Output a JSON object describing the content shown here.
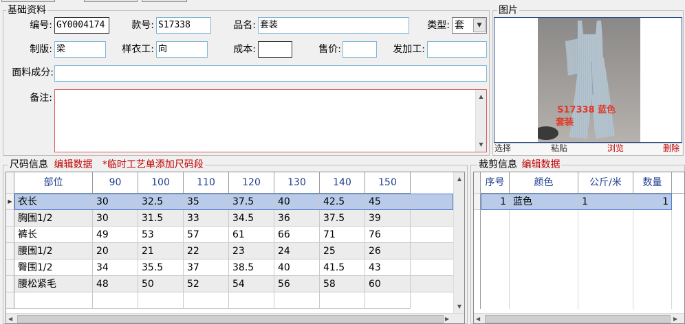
{
  "basic": {
    "title": "基础资料",
    "labels": {
      "code": "编号:",
      "style": "款号:",
      "name": "品名:",
      "type": "类型:",
      "maker": "制版:",
      "sample": "样衣工:",
      "cost": "成本:",
      "price": "售价:",
      "process": "发加工:",
      "fabric": "面料成分:",
      "remark": "备注:"
    },
    "values": {
      "code": "GY0004174",
      "style": "S17338",
      "name": "套装",
      "type": "套",
      "maker": "梁",
      "sample": "向",
      "cost": "",
      "price": "",
      "process": "",
      "fabric": "",
      "remark": ""
    }
  },
  "picture": {
    "title": "图片",
    "caption_line1": "S17338  蓝色",
    "caption_line2": "套装",
    "buttons": {
      "select": "选择",
      "paste": "粘贴",
      "browse": "浏览",
      "delete": "删除"
    }
  },
  "size_info": {
    "title": "尺码信息",
    "edit": "编辑数据",
    "note": "*临时工艺单添加尺码段",
    "headers": [
      "部位",
      "90",
      "100",
      "110",
      "120",
      "130",
      "140",
      "150"
    ],
    "rows": [
      [
        "衣长",
        "30",
        "32.5",
        "35",
        "37.5",
        "40",
        "42.5",
        "45"
      ],
      [
        "胸围1/2",
        "30",
        "31.5",
        "33",
        "34.5",
        "36",
        "37.5",
        "39"
      ],
      [
        "裤长",
        "49",
        "53",
        "57",
        "61",
        "66",
        "71",
        "76"
      ],
      [
        "腰围1/2",
        "20",
        "21",
        "22",
        "23",
        "24",
        "25",
        "26"
      ],
      [
        "臀围1/2",
        "34",
        "35.5",
        "37",
        "38.5",
        "40",
        "41.5",
        "43"
      ],
      [
        "腰松紧毛",
        "48",
        "50",
        "52",
        "54",
        "56",
        "58",
        "60"
      ]
    ]
  },
  "cut_info": {
    "title": "裁剪信息",
    "edit": "编辑数据",
    "headers": [
      "序号",
      "颜色",
      "公斤/米",
      "数量"
    ],
    "rows": [
      [
        "1",
        "蓝色",
        "1",
        "1"
      ]
    ]
  },
  "colors": {
    "accent_red": "#c00000",
    "selection": "#b9cbe9",
    "header_text": "#1f3f8f",
    "input_border": "#7fb7d6"
  }
}
